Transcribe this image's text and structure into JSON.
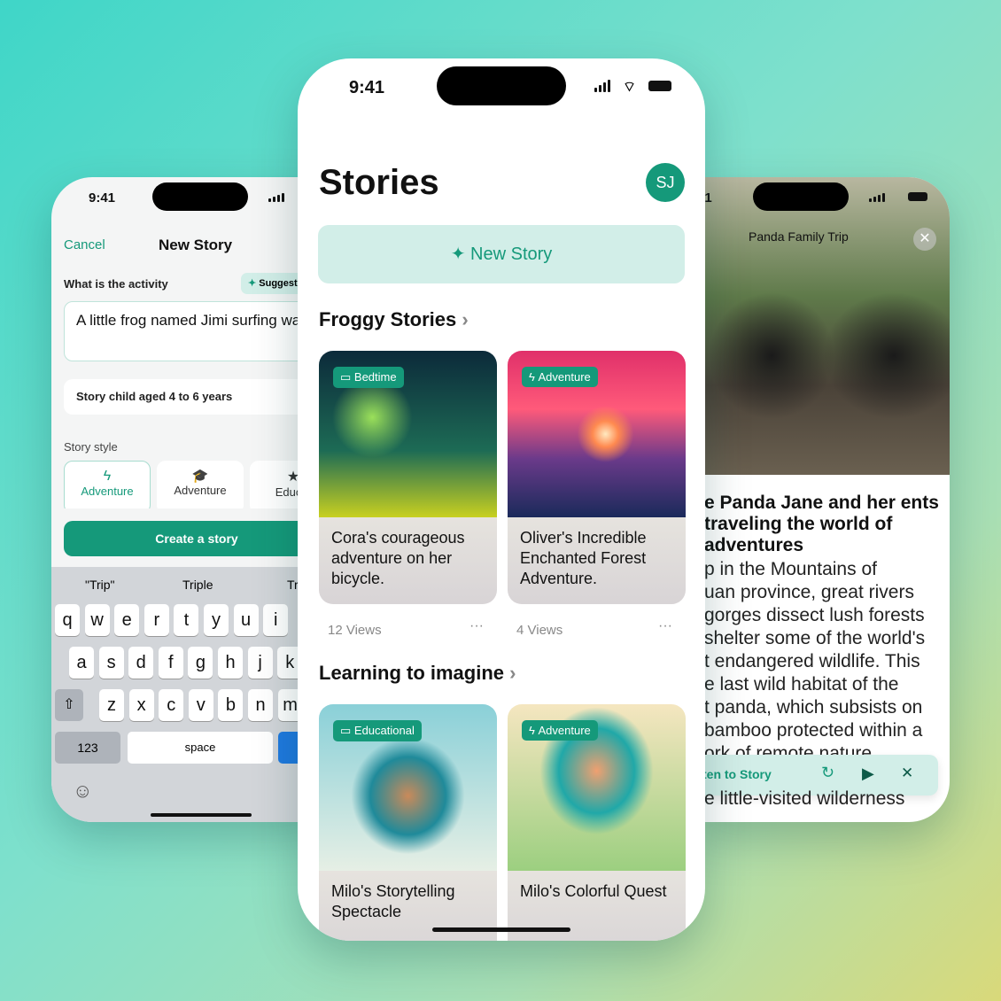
{
  "colors": {
    "accent": "#15997a",
    "accent_light": "#d2eee8"
  },
  "left_phone": {
    "status_time": "9:41",
    "nav": {
      "cancel": "Cancel",
      "title": "New Story"
    },
    "activity_label": "What is the activity",
    "suggest_button": "Suggest",
    "activity_value": "A little frog named Jimi surfing wa",
    "age_field": "Story child aged 4 to 6 years",
    "style_label": "Story style",
    "styles": [
      {
        "label": "Adventure",
        "icon": "bolt-icon",
        "selected": true
      },
      {
        "label": "Adventure",
        "icon": "graduation-cap-icon"
      },
      {
        "label": "Educat",
        "icon": "star-icon"
      }
    ],
    "create_button": "Create a story",
    "suggestions": [
      "\"Trip\"",
      "Triple",
      "Tr"
    ],
    "keyboard": {
      "row1": [
        "q",
        "w",
        "e",
        "r",
        "t",
        "y",
        "u",
        "i"
      ],
      "row2": [
        "a",
        "s",
        "d",
        "f",
        "g",
        "h",
        "j",
        "k"
      ],
      "row3": [
        "z",
        "x",
        "c",
        "v",
        "b",
        "n",
        "m"
      ],
      "numbers": "123",
      "space": "space"
    }
  },
  "center_phone": {
    "status_time": "9:41",
    "title": "Stories",
    "avatar": "SJ",
    "new_story_button": "New Story",
    "sections": [
      {
        "title": "Froggy Stories",
        "cards": [
          {
            "badge": "Bedtime",
            "badge_icon": "bed-icon",
            "caption": "Cora's courageous adventure on her bicycle.",
            "views": "12 Views"
          },
          {
            "badge": "Adventure",
            "badge_icon": "bolt-icon",
            "caption": "Oliver's Incredible Enchanted Forest Adventure.",
            "views": "4 Views"
          }
        ]
      },
      {
        "title": "Learning to imagine",
        "cards": [
          {
            "badge": "Educational",
            "badge_icon": "bed-icon",
            "caption": "Milo's Storytelling Spectacle"
          },
          {
            "badge": "Adventure",
            "badge_icon": "bolt-icon",
            "caption": "Milo's Colorful Quest"
          }
        ]
      }
    ]
  },
  "right_phone": {
    "status_time": "41",
    "story_title": "Panda Family Trip",
    "heading": "e Panda Jane and her ents traveling the world of adventures",
    "body": [
      "p in the Mountains of",
      "uan province, great rivers",
      "gorges dissect lush forests",
      "shelter some of the world's",
      "t endangered wildlife. This",
      "e last wild habitat of the",
      "t panda, which subsists on",
      "bamboo protected within a",
      "ork of remote nature"
    ],
    "body_after": "e little-visited wilderness",
    "player": {
      "label": "ten to Story"
    }
  }
}
